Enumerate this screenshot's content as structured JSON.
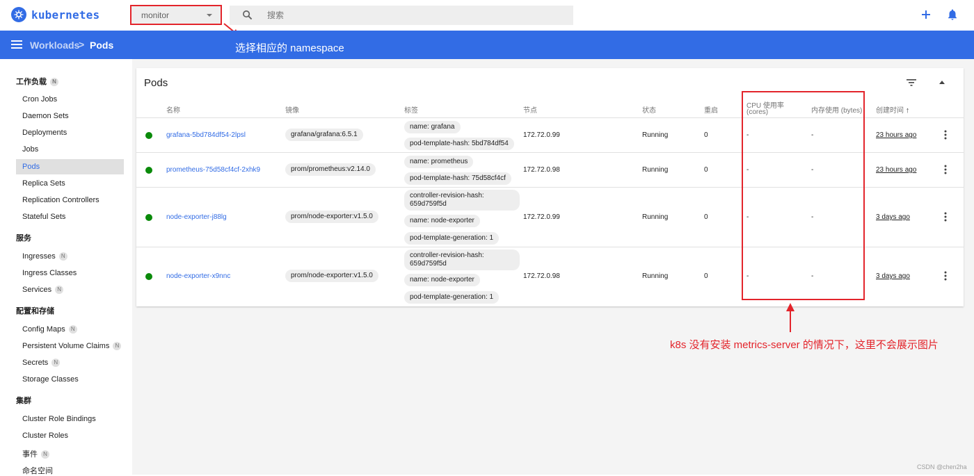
{
  "header": {
    "logo_text": "kubernetes",
    "namespace": "monitor",
    "search_placeholder": "搜索",
    "icons": [
      "kubernetes-logo-icon",
      "chevron-down-icon",
      "search-icon",
      "plus-icon",
      "bell-icon"
    ]
  },
  "breadcrumb": {
    "parent": "Workloads",
    "separator": ">",
    "current": "Pods"
  },
  "annotations": {
    "namespace_hint": "选择相应的 namespace",
    "metrics_hint": "k8s 没有安装 metrics-server 的情况下，这里不会展示图片"
  },
  "sidebar": {
    "badge": "N",
    "sections": [
      {
        "title": "工作负载",
        "badge": true,
        "items": [
          {
            "label": "Cron Jobs"
          },
          {
            "label": "Daemon Sets"
          },
          {
            "label": "Deployments"
          },
          {
            "label": "Jobs"
          },
          {
            "label": "Pods",
            "active": true
          },
          {
            "label": "Replica Sets"
          },
          {
            "label": "Replication Controllers"
          },
          {
            "label": "Stateful Sets"
          }
        ]
      },
      {
        "title": "服务",
        "items": [
          {
            "label": "Ingresses",
            "badge": true
          },
          {
            "label": "Ingress Classes"
          },
          {
            "label": "Services",
            "badge": true
          }
        ]
      },
      {
        "title": "配置和存储",
        "items": [
          {
            "label": "Config Maps",
            "badge": true
          },
          {
            "label": "Persistent Volume Claims",
            "badge": true
          },
          {
            "label": "Secrets",
            "badge": true
          },
          {
            "label": "Storage Classes"
          }
        ]
      },
      {
        "title": "集群",
        "items": [
          {
            "label": "Cluster Role Bindings"
          },
          {
            "label": "Cluster Roles"
          },
          {
            "label": "事件",
            "badge": true
          },
          {
            "label": "命名空间"
          }
        ]
      }
    ]
  },
  "pods_card": {
    "title": "Pods",
    "columns": {
      "name": "名称",
      "image": "镜像",
      "labels": "标签",
      "node": "节点",
      "status": "状态",
      "restarts": "重启",
      "cpu": "CPU 使用率",
      "cpu_unit": "(cores)",
      "memory": "内存使用 (bytes)",
      "created": "创建时间",
      "sort_arrow": "↑"
    },
    "rows": [
      {
        "status_color": "#0a8a0a",
        "name": "grafana-5bd784df54-2lpsl",
        "image": "grafana/grafana:6.5.1",
        "labels": [
          "name: grafana",
          "pod-template-hash: 5bd784df54"
        ],
        "node": "172.72.0.99",
        "status": "Running",
        "restarts": "0",
        "cpu": "-",
        "memory": "-",
        "created": "23 hours ago"
      },
      {
        "status_color": "#0a8a0a",
        "name": "prometheus-75d58cf4cf-2xhk9",
        "image": "prom/prometheus:v2.14.0",
        "labels": [
          "name: prometheus",
          "pod-template-hash: 75d58cf4cf"
        ],
        "node": "172.72.0.98",
        "status": "Running",
        "restarts": "0",
        "cpu": "-",
        "memory": "-",
        "created": "23 hours ago"
      },
      {
        "status_color": "#0a8a0a",
        "name": "node-exporter-j88lg",
        "image": "prom/node-exporter:v1.5.0",
        "labels": [
          "controller-revision-hash: 659d759f5d",
          "name: node-exporter",
          "pod-template-generation: 1"
        ],
        "node": "172.72.0.99",
        "status": "Running",
        "restarts": "0",
        "cpu": "-",
        "memory": "-",
        "created": "3 days ago"
      },
      {
        "status_color": "#0a8a0a",
        "name": "node-exporter-x9nnc",
        "image": "prom/node-exporter:v1.5.0",
        "labels": [
          "controller-revision-hash: 659d759f5d",
          "name: node-exporter",
          "pod-template-generation: 1"
        ],
        "node": "172.72.0.98",
        "status": "Running",
        "restarts": "0",
        "cpu": "-",
        "memory": "-",
        "created": "3 days ago"
      }
    ]
  },
  "watermark": "CSDN @chen2ha",
  "colors": {
    "brand": "#326ce5",
    "annotation": "#e3242b",
    "running": "#0a8a0a"
  }
}
